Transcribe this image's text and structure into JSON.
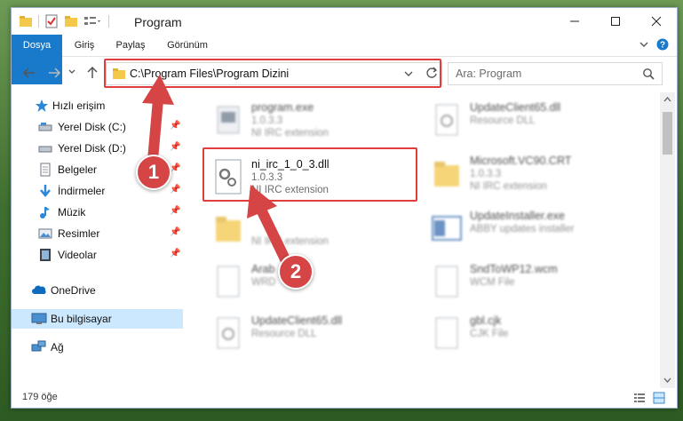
{
  "window": {
    "title": "Program"
  },
  "ribbon": {
    "tabs": [
      "Dosya",
      "Giriş",
      "Paylaş",
      "Görünüm"
    ]
  },
  "address": {
    "path": "C:\\Program Files\\Program Dizini"
  },
  "search": {
    "placeholder": "Ara: Program"
  },
  "sidebar": {
    "items": [
      {
        "label": "Hızlı erişim",
        "icon": "star-icon",
        "pinned": false
      },
      {
        "label": "Yerel Disk (C:)",
        "icon": "drive-icon",
        "pinned": true
      },
      {
        "label": "Yerel Disk (D:)",
        "icon": "drive-icon",
        "pinned": true
      },
      {
        "label": "Belgeler",
        "icon": "document-icon",
        "pinned": true
      },
      {
        "label": "İndirmeler",
        "icon": "download-icon",
        "pinned": true
      },
      {
        "label": "Müzik",
        "icon": "music-icon",
        "pinned": true
      },
      {
        "label": "Resimler",
        "icon": "pictures-icon",
        "pinned": true
      },
      {
        "label": "Videolar",
        "icon": "video-icon",
        "pinned": true
      },
      {
        "label": "OneDrive",
        "icon": "cloud-icon",
        "pinned": false
      },
      {
        "label": "Bu bilgisayar",
        "icon": "computer-icon",
        "pinned": false,
        "selected": true
      },
      {
        "label": "Ağ",
        "icon": "network-icon",
        "pinned": false
      }
    ]
  },
  "files": [
    {
      "name": "program.exe",
      "line2": "1.0.3.3",
      "line3": "NI IRC extension",
      "focused": false
    },
    {
      "name": "UpdateClient65.dll",
      "line2": "Resource DLL",
      "line3": "",
      "focused": false
    },
    {
      "name": "ni_irc_1_0_3.dll",
      "line2": "1.0.3.3",
      "line3": "NI IRC extension",
      "focused": true
    },
    {
      "name": "Microsoft.VC90.CRT",
      "line2": "1.0.3.3",
      "line3": "NI IRC extension",
      "focused": false
    },
    {
      "name": "",
      "line2": "",
      "line3": "NI IRC extension",
      "focused": false
    },
    {
      "name": "UpdateInstaller.exe",
      "line2": "ABBY updates installer",
      "line3": "",
      "focused": false
    },
    {
      "name": "Arab",
      "line2": "WRD",
      "line3": "",
      "focused": false
    },
    {
      "name": "SndToWP12.wcm",
      "line2": "WCM File",
      "line3": "",
      "focused": false
    },
    {
      "name": "UpdateClient65.dll",
      "line2": "Resource DLL",
      "line3": "",
      "focused": false
    },
    {
      "name": "gbl.cjk",
      "line2": "CJK File",
      "line3": "",
      "focused": false
    }
  ],
  "status": {
    "count": "179 öğe"
  },
  "annotations": {
    "badge1": "1",
    "badge2": "2"
  },
  "colors": {
    "accent": "#1979ca",
    "highlight": "#e03d3d",
    "selected": "#cce8ff"
  }
}
